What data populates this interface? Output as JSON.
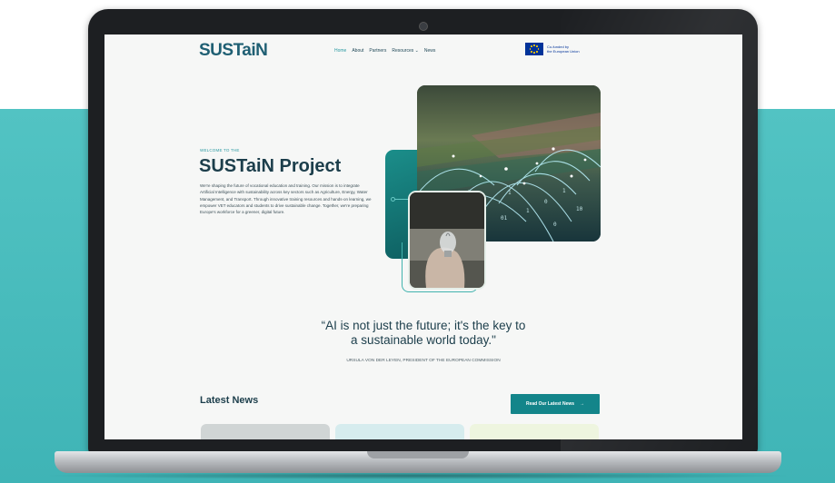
{
  "header": {
    "logo_text": "SUSTaiN",
    "logo_subtitle": "",
    "nav": [
      "Home",
      "About",
      "Partners",
      "Resources",
      "News"
    ],
    "nav_active": "Home",
    "resources_chevron": "chevron-down-icon",
    "eu_line1": "Co-funded by",
    "eu_line2": "the European Union"
  },
  "hero": {
    "eyebrow": "WELCOME TO THE",
    "title": "SUSTaiN Project",
    "body": "We're shaping the future of vocational education and training. Our mission is to integrate Artificial Intelligence with sustainability across key sectors such as Agriculture, Energy, Water Management, and Transport. Through innovative training resources and hands-on learning, we empower VET educators and students to drive sustainable change. Together, we're preparing Europe's workforce for a greener, digital future."
  },
  "quote": {
    "line1": "“AI is not just the future; it's the key to",
    "line2": "a sustainable world today.\"",
    "author": "URSULA VON DER LEYEN, PRESIDENT OF THE EUROPEAN COMMISSION"
  },
  "news": {
    "title": "Latest News",
    "button_label": "Read Our Latest News",
    "button_icon": "arrow-right-icon",
    "card_colors": [
      "#d0d5d5",
      "#d6ecee",
      "#eef5df"
    ]
  },
  "colors": {
    "accent": "#13858a",
    "dark_text": "#1c3e4b",
    "background_band": "#4ab9bb"
  }
}
